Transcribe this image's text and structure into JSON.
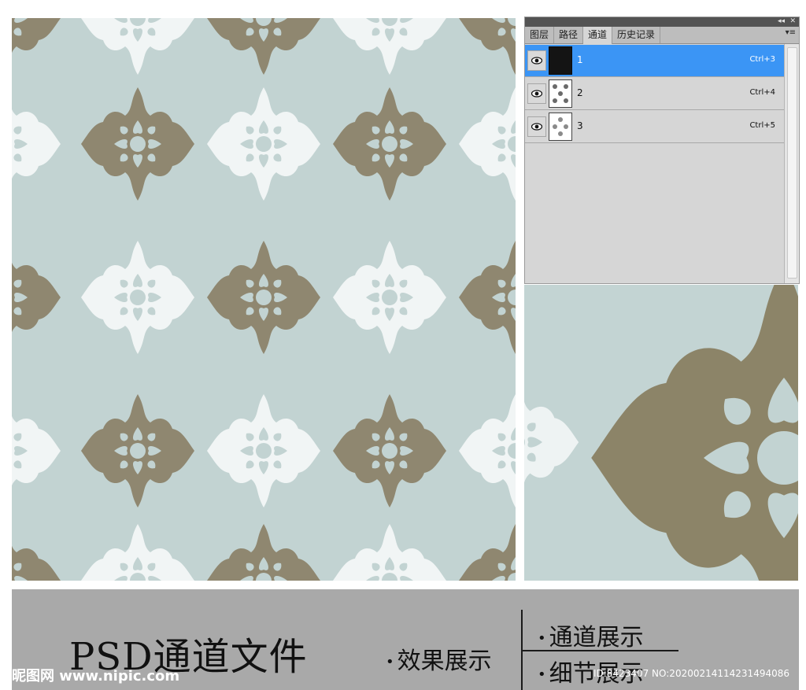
{
  "panel": {
    "collapse_glyph": "◂◂",
    "close_glyph": "✕",
    "menu_glyph": "▾≡",
    "tabs": [
      {
        "label": "图层"
      },
      {
        "label": "路径"
      },
      {
        "label": "通道"
      },
      {
        "label": "历史记录"
      }
    ],
    "active_tab_index": 2,
    "channels": [
      {
        "name": "1",
        "shortcut": "Ctrl+3",
        "selected": true,
        "visible": true
      },
      {
        "name": "2",
        "shortcut": "Ctrl+4",
        "selected": false,
        "visible": true
      },
      {
        "name": "3",
        "shortcut": "Ctrl+5",
        "selected": false,
        "visible": true
      }
    ],
    "colors": {
      "selection": "#3b95f5",
      "panel_bg": "#d6d6d6"
    }
  },
  "pattern": {
    "background_color": "#c2d3d2",
    "motif_colors": {
      "tan": "#8f8770",
      "white": "#f1f5f5"
    },
    "icon": "damask-medallion"
  },
  "banner": {
    "title": "PSD通道文件",
    "labels": {
      "effect": "效果展示",
      "channel": "通道展示",
      "detail": "细节展示"
    },
    "bullet": "•",
    "watermark_logo": "昵图网 www.nipic.com",
    "watermark_id": "ID:8423407 NO:20200214114231494086"
  }
}
